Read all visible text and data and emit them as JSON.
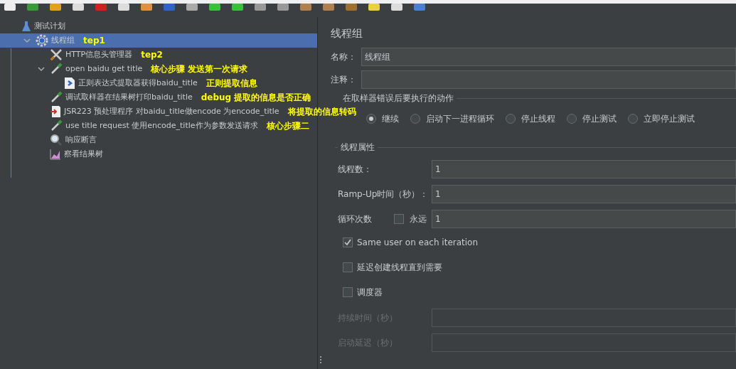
{
  "tree": [
    {
      "label": "测试计划",
      "kind": "plan",
      "selected": false,
      "children": [
        {
          "label": "线程组",
          "kind": "threadgroup",
          "selected": true,
          "expanded": true,
          "note": "tep1",
          "children": [
            {
              "label": "HTTP信息头管理器",
              "kind": "config",
              "selected": false,
              "note": "tep2"
            },
            {
              "label": "open baidu get title",
              "kind": "sampler",
              "selected": false,
              "expanded": true,
              "note": "核心步骤 发送第一次请求",
              "children": [
                {
                  "label": "正则表达式提取器获得baidu_title",
                  "kind": "extractor",
                  "selected": false,
                  "note": "正则提取信息"
                }
              ]
            },
            {
              "label": "调试取样器在结果树打印baidu_title",
              "kind": "sampler",
              "selected": false,
              "note": "debug 提取的信息是否正确"
            },
            {
              "label": "JSR223 预处理程序  对baidu_title做encode 为encode_title",
              "kind": "preprocessor",
              "selected": false,
              "note": "将提取的信息转码"
            },
            {
              "label": "use title request  使用encode_title作为参数发送请求",
              "kind": "sampler",
              "selected": false,
              "note": "核心步骤二"
            },
            {
              "label": "响应断言",
              "kind": "assertion",
              "selected": false
            },
            {
              "label": "察看结果树",
              "kind": "listener",
              "selected": false
            }
          ]
        }
      ]
    }
  ],
  "panel": {
    "title": "线程组",
    "name_label": "名称：",
    "name_value": "线程组",
    "comment_label": "注释：",
    "error_action": {
      "legend": "在取样器错误后要执行的动作",
      "options": [
        {
          "label": "继续",
          "selected": true
        },
        {
          "label": "启动下一进程循环",
          "selected": false
        },
        {
          "label": "停止线程",
          "selected": false
        },
        {
          "label": "停止测试",
          "selected": false
        },
        {
          "label": "立即停止测试",
          "selected": false
        }
      ]
    },
    "properties": {
      "legend": "线程属性",
      "threads_label": "线程数：",
      "threads_value": "1",
      "rampup_label": "Ramp-Up时间（秒）：",
      "rampup_value": "1",
      "loop_label": "循环次数",
      "forever_label": "永远",
      "forever_checked": false,
      "loop_value": "1",
      "checks": [
        {
          "label": "Same user on each iteration",
          "checked": true
        },
        {
          "label": "延迟创建线程直到需要",
          "checked": false
        },
        {
          "label": "调度器",
          "checked": false
        }
      ],
      "duration_label": "持续时间（秒）",
      "delay_label": "启动延迟（秒）",
      "disabled_fields": true
    }
  }
}
